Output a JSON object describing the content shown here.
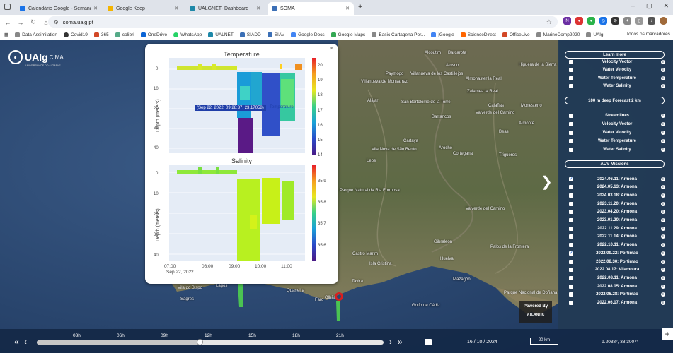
{
  "browser": {
    "tabs": [
      {
        "title": "Calendário Google - Semana de",
        "color": "#1a73e8",
        "active": false
      },
      {
        "title": "Google Keep",
        "color": "#f4b400",
        "active": false
      },
      {
        "title": "UALGNET- Dashboard",
        "color": "#1e88a8",
        "active": false
      },
      {
        "title": "SOMA",
        "color": "#3b6fb6",
        "active": true
      }
    ],
    "url": "soma.ualg.pt",
    "bookmarks": [
      "Data Assimilation",
      "Covid19",
      "365",
      "colibri",
      "OneDrive",
      "WhatsApp",
      "UALNET",
      "SIADD",
      "SIAV",
      "Google Docs",
      "Google Maps",
      "Basic Cartagena Por...",
      "jGoogle",
      "ScienceDirect",
      "OfficeLive",
      "MarineComp2020",
      "UAlg"
    ],
    "bookmarks_right": "Todos os marcadores"
  },
  "logo": {
    "name": "UAlg",
    "sub": "CIMA",
    "tagline": "UNIVERSIDADE DO ALGARVE"
  },
  "places": [
    {
      "text": "Alcoutim",
      "x": 600,
      "y": 15
    },
    {
      "text": "Barcarota",
      "x": 633,
      "y": 15
    },
    {
      "text": "Alosno",
      "x": 630,
      "y": 33
    },
    {
      "text": "Higuera de la Sierra",
      "x": 733,
      "y": 32
    },
    {
      "text": "Almonaster la Real",
      "x": 658,
      "y": 52
    },
    {
      "text": "Villanueva de los Castillejos",
      "x": 580,
      "y": 45
    },
    {
      "text": "Paymogo",
      "x": 545,
      "y": 45
    },
    {
      "text": "Zalamea la Real",
      "x": 660,
      "y": 70
    },
    {
      "text": "San Bartolomé de la Torre",
      "x": 567,
      "y": 85
    },
    {
      "text": "Alájar",
      "x": 519,
      "y": 83
    },
    {
      "text": "Valverde del Camino",
      "x": 672,
      "y": 100
    },
    {
      "text": "Calañas",
      "x": 690,
      "y": 90
    },
    {
      "text": "Villanueva de Monsarraz",
      "x": 510,
      "y": 56
    },
    {
      "text": "Barrancos",
      "x": 610,
      "y": 106
    },
    {
      "text": "Beas",
      "x": 705,
      "y": 127
    },
    {
      "text": "Almonte",
      "x": 733,
      "y": 115
    },
    {
      "text": "Trigueros",
      "x": 705,
      "y": 160
    },
    {
      "text": "Monesterio",
      "x": 736,
      "y": 90
    },
    {
      "text": "Cartaya",
      "x": 570,
      "y": 140
    },
    {
      "text": "Lepe",
      "x": 518,
      "y": 168
    },
    {
      "text": "Vila Nova de São Bento",
      "x": 525,
      "y": 152
    },
    {
      "text": "Aroche",
      "x": 620,
      "y": 150
    },
    {
      "text": "Cortegana",
      "x": 640,
      "y": 158
    },
    {
      "text": "Parque Natural da Ria Formosa",
      "x": 480,
      "y": 210
    },
    {
      "text": "Valverde del Camino",
      "x": 658,
      "y": 236
    },
    {
      "text": "Gibraleón",
      "x": 613,
      "y": 283
    },
    {
      "text": "Palos de la Frontera",
      "x": 693,
      "y": 290
    },
    {
      "text": "Huelva",
      "x": 622,
      "y": 307
    },
    {
      "text": "Isla Cristina",
      "x": 522,
      "y": 314
    },
    {
      "text": "Castro Marim",
      "x": 498,
      "y": 300
    },
    {
      "text": "Tavira",
      "x": 497,
      "y": 339
    },
    {
      "text": "Mazagón",
      "x": 640,
      "y": 336
    },
    {
      "text": "Faro",
      "x": 445,
      "y": 365
    },
    {
      "text": "Olhão",
      "x": 459,
      "y": 362
    },
    {
      "text": "Quarteira",
      "x": 405,
      "y": 352
    },
    {
      "text": "Vila do Bispo",
      "x": 251,
      "y": 348
    },
    {
      "text": "Lagos",
      "x": 305,
      "y": 345
    },
    {
      "text": "Sagres",
      "x": 255,
      "y": 364
    },
    {
      "text": "Golfo de Cádiz",
      "x": 582,
      "y": 373
    },
    {
      "text": "Parque Nacional de Doñana",
      "x": 712,
      "y": 355
    }
  ],
  "popup": {
    "temperature": {
      "title": "Temperature",
      "ylabel": "Depth (meters)",
      "yticks": [
        "0",
        "10",
        "20",
        "30",
        "40"
      ],
      "colorbar_ticks": [
        "20",
        "19",
        "18",
        "17",
        "16",
        "15",
        "14"
      ],
      "tooltip": "(Sep 22, 2022, 09:28:37, 23.17058)",
      "tooltip_label": "Temperature"
    },
    "salinity": {
      "title": "Salinity",
      "ylabel": "Depth (meters)",
      "yticks": [
        "0",
        "10",
        "20",
        "30",
        "40"
      ],
      "colorbar_ticks": [
        "35.9",
        "35.8",
        "35.7",
        "35.6"
      ]
    },
    "xticks": [
      "07:00",
      "08:00",
      "09:00",
      "10:00",
      "11:00"
    ],
    "xdate": "Sep 22, 2022"
  },
  "panel": {
    "learn_more": "Learn more",
    "group1": [
      "Velocity Vector",
      "Water Velocity",
      "Water Temperature",
      "Water Salinity"
    ],
    "forecast_title": "100 m deep Forecast 2 km",
    "group2": [
      "Streamlines",
      "Velocity Vector",
      "Water Velocity",
      "Water Temperature",
      "Water Salinity"
    ],
    "auv_title": "AUV Missions",
    "missions": [
      {
        "label": "2024.06.11: Armona",
        "checked": true
      },
      {
        "label": "2024.05.13: Armona",
        "checked": false
      },
      {
        "label": "2024.03.18: Armona",
        "checked": false
      },
      {
        "label": "2023.11.20: Armona",
        "checked": false
      },
      {
        "label": "2023.04.20: Armona",
        "checked": false
      },
      {
        "label": "2023.01.20: Armona",
        "checked": false
      },
      {
        "label": "2022.11.29: Armona",
        "checked": false
      },
      {
        "label": "2022.11.14: Armona",
        "checked": false
      },
      {
        "label": "2022.10.11: Armona",
        "checked": false
      },
      {
        "label": "2022.09.22: Portimao",
        "checked": true
      },
      {
        "label": "2022.08.30: Portimao",
        "checked": false
      },
      {
        "label": "2022.08.17: Vilamoura",
        "checked": false
      },
      {
        "label": "2022.08.11: Armona",
        "checked": false
      },
      {
        "label": "2022.08.05: Armona",
        "checked": false
      },
      {
        "label": "2022.06.28: Portimao",
        "checked": false
      },
      {
        "label": "2022.06.17: Armona",
        "checked": false
      }
    ]
  },
  "timebar": {
    "hours": [
      "03h",
      "06h",
      "09h",
      "12h",
      "15h",
      "18h",
      "21h"
    ],
    "progress": 0.47,
    "date": "16 / 10 / 2024",
    "scale": "20 km",
    "coords": "-9.2038°, 38.3007°"
  },
  "powered_by": "Powered By",
  "powered_brand": "ATLANTIC"
}
